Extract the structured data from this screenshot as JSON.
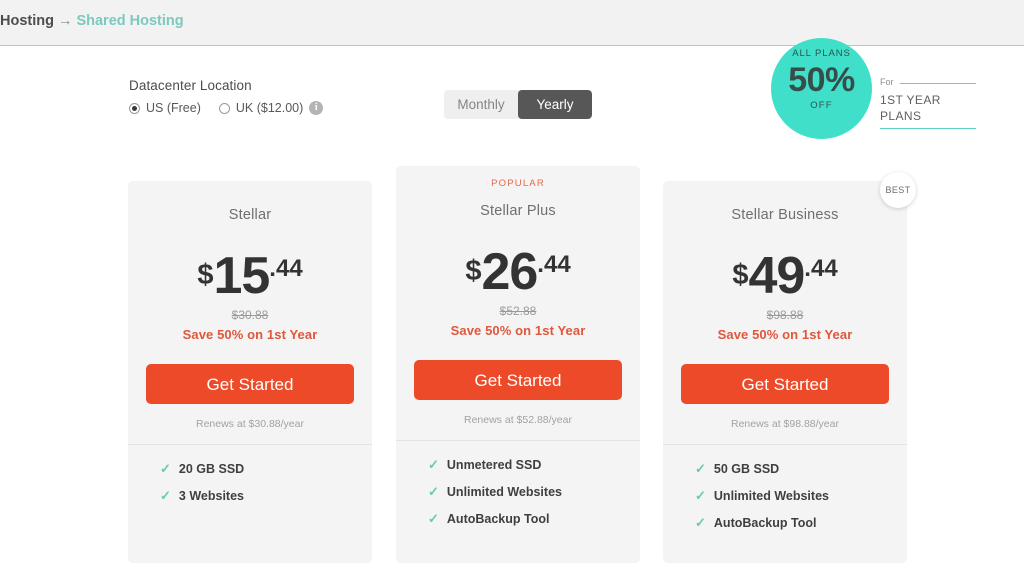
{
  "breadcrumb": {
    "root": "Hosting",
    "separator": "→",
    "current": "Shared Hosting"
  },
  "datacenter": {
    "title": "Datacenter Location",
    "options": [
      {
        "label": "US (Free)",
        "selected": true
      },
      {
        "label": "UK ($12.00)",
        "selected": false
      }
    ],
    "info_icon": "info-icon",
    "info_glyph": "i"
  },
  "billing": {
    "monthly_label": "Monthly",
    "yearly_label": "Yearly",
    "active": "Yearly"
  },
  "discount": {
    "all_plans": "ALL PLANS",
    "percent": "50%",
    "off": "OFF",
    "for_label": "For",
    "line1": "1ST YEAR",
    "line2": "PLANS",
    "circle_color": "#3fdfc9",
    "rule_color": "#5fd3c2"
  },
  "best_badge": {
    "label": "BEST"
  },
  "cta_color": "#ec4a28",
  "accent_teal": "#67c9b4",
  "save_color": "#e0573c",
  "plans": [
    {
      "tag": "",
      "name": "Stellar",
      "currency": "$",
      "price_whole": "15",
      "price_cents": ".44",
      "old_price": "$30.88",
      "save_note": "Save 50% on 1st Year",
      "cta_label": "Get Started",
      "renew_note": "Renews at $30.88/year",
      "features": [
        "20 GB SSD",
        "3 Websites"
      ]
    },
    {
      "tag": "POPULAR",
      "name": "Stellar Plus",
      "currency": "$",
      "price_whole": "26",
      "price_cents": ".44",
      "old_price": "$52.88",
      "save_note": "Save 50% on 1st Year",
      "cta_label": "Get Started",
      "renew_note": "Renews at $52.88/year",
      "features": [
        "Unmetered SSD",
        "Unlimited Websites",
        "AutoBackup Tool"
      ]
    },
    {
      "tag": "",
      "name": "Stellar Business",
      "currency": "$",
      "price_whole": "49",
      "price_cents": ".44",
      "old_price": "$98.88",
      "save_note": "Save 50% on 1st Year",
      "cta_label": "Get Started",
      "renew_note": "Renews at $98.88/year",
      "features": [
        "50 GB SSD",
        "Unlimited Websites",
        "AutoBackup Tool"
      ]
    }
  ]
}
